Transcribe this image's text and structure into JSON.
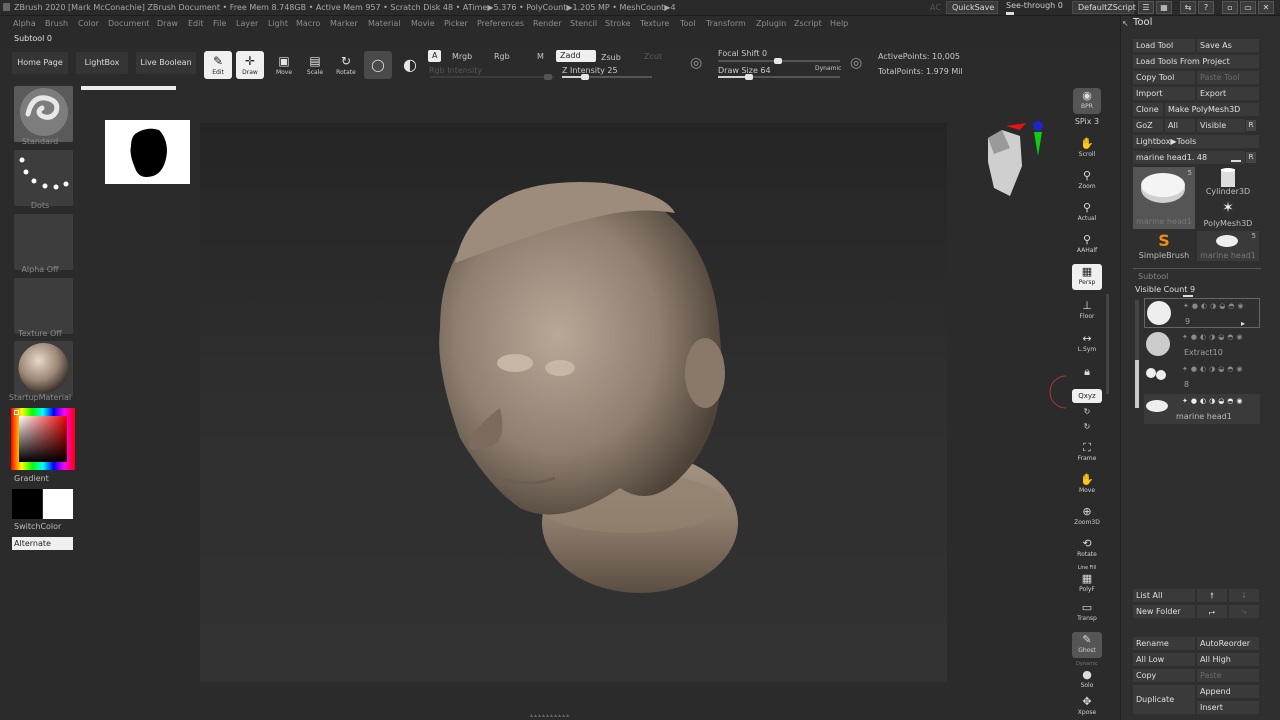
{
  "titlebar": {
    "title": "ZBrush 2020 [Mark McConachie]   ZBrush Document   • Free Mem 8.748GB • Active Mem 957 • Scratch Disk 48 • ATime▶5.376 • PolyCount▶1.205 MP • MeshCount▶4",
    "ac": "AC",
    "quicksave": "QuickSave",
    "seethrough": "See-through  0",
    "script": "DefaultZScript",
    "min": "▫",
    "restore": "▭",
    "close": "✕",
    "menus": "☰"
  },
  "menubar": [
    "Alpha",
    "Brush",
    "Color",
    "Document",
    "Draw",
    "Edit",
    "File",
    "Layer",
    "Light",
    "Macro",
    "Marker",
    "Material",
    "Movie",
    "Picker",
    "Preferences",
    "Render",
    "Stencil",
    "Stroke",
    "Texture",
    "Tool",
    "Transform",
    "Zplugin",
    "Zscript",
    "Help"
  ],
  "subtool_label": "Subtool 0",
  "toolbar": {
    "home": "Home Page",
    "lightbox": "LightBox",
    "liveboolean": "Live Boolean",
    "edit": "Edit",
    "draw": "Draw",
    "move": "Move",
    "scale": "Scale",
    "rotate": "Rotate",
    "a": "A",
    "mrgb": "Mrgb",
    "rgb": "Rgb",
    "m": "M",
    "zadd": "Zadd",
    "zsub": "Zsub",
    "zcut": "Zcut",
    "rgb_intensity": "Rgb Intensity",
    "z_intensity": "Z Intensity 25",
    "focal_shift": "Focal Shift 0",
    "draw_size": "Draw Size 64",
    "dynamic": "Dynamic",
    "active_points": "ActivePoints: 10,005",
    "total_points": "TotalPoints: 1.979 Mil",
    "z_intensity_value": 25,
    "z_intensity_max": 100,
    "draw_size_value": 64,
    "draw_size_max": 1000
  },
  "left": {
    "brush": "Standard",
    "stroke": "Dots",
    "alpha": "Alpha Off",
    "texture": "Texture Off",
    "material": "StartupMaterial",
    "gradient": "Gradient",
    "switchcolor": "SwitchColor",
    "alternate": "Alternate"
  },
  "rightshelf": {
    "bpr": "BPR",
    "spix": "SPix 3",
    "scroll": "Scroll",
    "zoom": "Zoom",
    "actual": "Actual",
    "aahalf": "AAHalf",
    "persp": "Persp",
    "floor": "Floor",
    "lsym": "L.Sym",
    "lock": "",
    "xyz": "Qxyz",
    "frame": "Frame",
    "move": "Move",
    "zoom3d": "Zoom3D",
    "rotate": "Rotate",
    "linefill": "Line Fill",
    "polyf": "PolyF",
    "transp": "Transp",
    "ghost": "Ghost",
    "dynamic": "Dynamic",
    "solo": "Solo",
    "xpose": "Xpose"
  },
  "toolpanel": {
    "header": "Tool",
    "load_tool": "Load Tool",
    "save_as": "Save As",
    "load_from_project": "Load Tools From Project",
    "copy_tool": "Copy Tool",
    "paste_tool": "Paste Tool",
    "import": "Import",
    "export": "Export",
    "clone": "Clone",
    "make_polymesh": "Make PolyMesh3D",
    "goz": "GoZ",
    "all": "All",
    "visible": "Visible",
    "r": "R",
    "lightbox_tools": "Lightbox▶Tools",
    "current_tool": "marine head1. 48",
    "thumbs": [
      {
        "label": "marine head1",
        "count": "5"
      },
      {
        "label": "Cylinder3D",
        "count": ""
      },
      {
        "label": "PolyMesh3D",
        "count": ""
      },
      {
        "label": "SimpleBrush",
        "count": ""
      },
      {
        "label": "marine head1",
        "count": "5"
      }
    ],
    "subtool_header": "Subtool",
    "visible_count": "Visible Count 9",
    "visible_count_value": 9,
    "visible_count_max": 9,
    "subtools": [
      {
        "label": "9"
      },
      {
        "label": "Extract10"
      },
      {
        "label": "8"
      },
      {
        "label": "marine head1"
      }
    ],
    "list_all": "List All",
    "new_folder": "New Folder",
    "rename": "Rename",
    "autoreorder": "AutoReorder",
    "all_low": "All Low",
    "all_high": "All High",
    "copy": "Copy",
    "paste": "Paste",
    "duplicate": "Duplicate",
    "append": "Append",
    "insert": "Insert"
  }
}
